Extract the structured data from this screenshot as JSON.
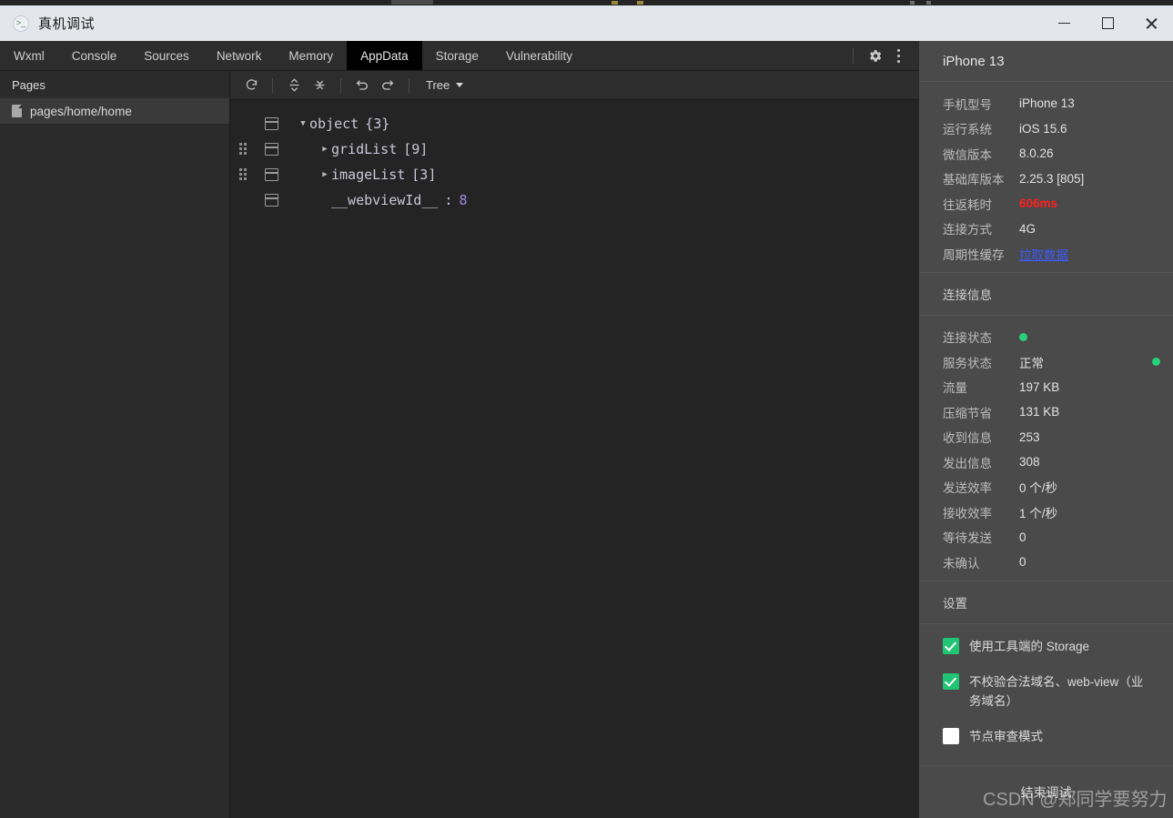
{
  "window": {
    "title": "真机调试",
    "app_icon": "terminal-icon",
    "minimize_label": "—",
    "maximize_label": "□",
    "close_label": "✕"
  },
  "tabbar": {
    "tabs": [
      {
        "label": "Wxml",
        "active": false
      },
      {
        "label": "Console",
        "active": false
      },
      {
        "label": "Sources",
        "active": false
      },
      {
        "label": "Network",
        "active": false
      },
      {
        "label": "Memory",
        "active": false
      },
      {
        "label": "AppData",
        "active": true
      },
      {
        "label": "Storage",
        "active": false
      },
      {
        "label": "Vulnerability",
        "active": false
      }
    ],
    "settings_icon": "gear-icon",
    "more_icon": "kebab-menu-icon"
  },
  "sidebar": {
    "title": "Pages",
    "items": [
      {
        "label": "pages/home/home",
        "icon": "file-icon",
        "selected": true
      }
    ]
  },
  "main": {
    "toolbar": {
      "refresh_icon": "refresh-icon",
      "collapse_icon": "collapse-all-icon",
      "expand_icon": "expand-all-icon",
      "undo_icon": "undo-icon",
      "redo_icon": "redo-icon",
      "view_mode": "Tree"
    },
    "tree": [
      {
        "depth": 0,
        "twisty": "▼",
        "key": "object",
        "count": "{3}",
        "value": "",
        "handle": false
      },
      {
        "depth": 1,
        "twisty": "▶",
        "key": "gridList",
        "count": "[9]",
        "value": "",
        "handle": true
      },
      {
        "depth": 1,
        "twisty": "▶",
        "key": "imageList",
        "count": "[3]",
        "value": "",
        "handle": true
      },
      {
        "depth": 1,
        "twisty": "",
        "key": "__webviewId__",
        "count": "",
        "value": "8",
        "handle": false
      }
    ]
  },
  "rightpanel": {
    "device_name": "iPhone 13",
    "device_info": [
      {
        "key": "手机型号",
        "value": "iPhone 13",
        "style": "normal"
      },
      {
        "key": "运行系统",
        "value": "iOS 15.6",
        "style": "normal"
      },
      {
        "key": "微信版本",
        "value": "8.0.26",
        "style": "normal"
      },
      {
        "key": "基础库版本",
        "value": "2.25.3 [805]",
        "style": "normal"
      },
      {
        "key": "往返耗时",
        "value": "606ms",
        "style": "red"
      },
      {
        "key": "连接方式",
        "value": "4G",
        "style": "normal"
      },
      {
        "key": "周期性缓存",
        "value": "拉取数据",
        "style": "link"
      }
    ],
    "connection_title": "连接信息",
    "connection_info": [
      {
        "key": "连接状态",
        "value": "",
        "style": "dot"
      },
      {
        "key": "服务状态",
        "value": "正常",
        "style": "dot-right"
      },
      {
        "key": "流量",
        "value": "197 KB",
        "style": "normal"
      },
      {
        "key": "压缩节省",
        "value": "131 KB",
        "style": "normal"
      },
      {
        "key": "收到信息",
        "value": "253",
        "style": "normal"
      },
      {
        "key": "发出信息",
        "value": "308",
        "style": "normal"
      },
      {
        "key": "发送效率",
        "value": "0 个/秒",
        "style": "normal"
      },
      {
        "key": "接收效率",
        "value": "1 个/秒",
        "style": "normal"
      },
      {
        "key": "等待发送",
        "value": "0",
        "style": "normal"
      },
      {
        "key": "未确认",
        "value": "0",
        "style": "normal"
      }
    ],
    "settings_title": "设置",
    "settings": [
      {
        "label": "使用工具端的 Storage",
        "checked": true
      },
      {
        "label": "不校验合法域名、web-view（业务域名）",
        "checked": true
      },
      {
        "label": "节点审查模式",
        "checked": false
      }
    ],
    "end_debug_label": "结束调试"
  },
  "watermark": "CSDN @郑同学要努力",
  "colors": {
    "accent_green": "#21c473",
    "status_red": "#ff1f1f",
    "link_blue": "#3b5bff",
    "tab_active_bg": "#000000",
    "panel_bg": "#4a4a4a",
    "editor_bg": "#242424"
  }
}
